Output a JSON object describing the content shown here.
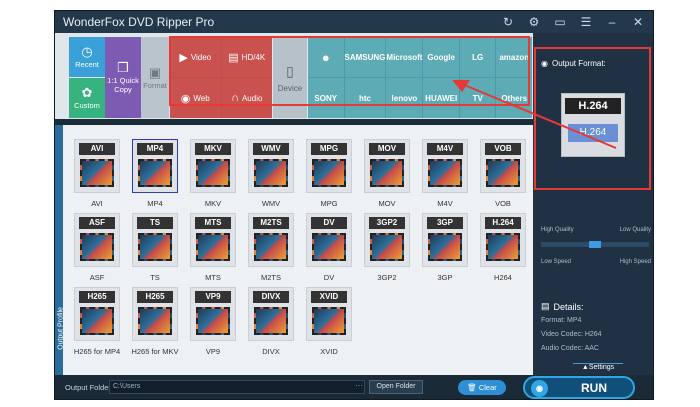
{
  "app": {
    "title": "WonderFox DVD Ripper Pro"
  },
  "ribbon": {
    "recent": "Recent",
    "custom": "Custom",
    "quick": "1:1 Quick Copy",
    "format": "Format",
    "device": "Device",
    "categories": [
      {
        "label": "Video",
        "icon": "play-icon"
      },
      {
        "label": "HD/4K",
        "icon": "hd-icon"
      },
      {
        "label": "Web",
        "icon": "web-icon"
      },
      {
        "label": "Audio",
        "icon": "headphones-icon"
      }
    ],
    "brands": [
      {
        "label": "",
        "icon": "apple-icon"
      },
      {
        "label": "SAMSUNG"
      },
      {
        "label": "Microsoft"
      },
      {
        "label": "Google"
      },
      {
        "label": "LG"
      },
      {
        "label": "amazon"
      },
      {
        "label": "SONY"
      },
      {
        "label": "htc"
      },
      {
        "label": "lenovo"
      },
      {
        "label": "HUAWEI"
      },
      {
        "label": "TV"
      },
      {
        "label": "Others"
      }
    ]
  },
  "sidebar_tab": "Output Profile",
  "formats": [
    {
      "badge": "AVI",
      "label": "AVI"
    },
    {
      "badge": "MP4",
      "label": "MP4",
      "selected": true
    },
    {
      "badge": "MKV",
      "label": "MKV"
    },
    {
      "badge": "WMV",
      "label": "WMV"
    },
    {
      "badge": "MPG",
      "label": "MPG"
    },
    {
      "badge": "MOV",
      "label": "MOV"
    },
    {
      "badge": "M4V",
      "label": "M4V"
    },
    {
      "badge": "VOB",
      "label": "VOB"
    },
    {
      "badge": "ASF",
      "label": "ASF"
    },
    {
      "badge": "TS",
      "label": "TS"
    },
    {
      "badge": "MTS",
      "label": "MTS"
    },
    {
      "badge": "M2TS",
      "label": "M2TS"
    },
    {
      "badge": "DV",
      "label": "DV"
    },
    {
      "badge": "3GP2",
      "label": "3GP2"
    },
    {
      "badge": "3GP",
      "label": "3GP"
    },
    {
      "badge": "H.264",
      "label": "H264"
    },
    {
      "badge": "H265",
      "label": "H265 for MP4"
    },
    {
      "badge": "H265",
      "label": "H265 for MKV"
    },
    {
      "badge": "VP9",
      "label": "VP9"
    },
    {
      "badge": "DIVX",
      "label": "DIVX"
    },
    {
      "badge": "XVID",
      "label": "XVID"
    }
  ],
  "output_panel": {
    "heading": "Output Format:",
    "preview_top": "H.264",
    "preview_bottom": "H.264",
    "high_quality": "High Quality",
    "low_quality": "Low Quality",
    "low_speed": "Low Speed",
    "high_speed": "High Speed",
    "quality_level": 0.5,
    "details_heading": "Details:",
    "details": [
      "Format: MP4",
      "Video Codec: H264",
      "Audio Codec: AAC"
    ],
    "settings": "Settings"
  },
  "bottom": {
    "output_folder_label": "Output Folder:",
    "output_folder_value": "C:\\Users",
    "browse": "···",
    "open_folder": "Open Folder",
    "clear": "Clear",
    "run": "RUN"
  },
  "colors": {
    "accent": "#2fa6e5",
    "highlight": "#e53935"
  }
}
